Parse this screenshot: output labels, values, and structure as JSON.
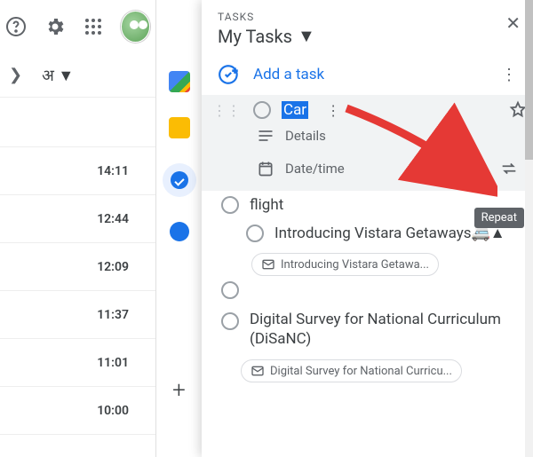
{
  "header": {
    "lang_label": "अ",
    "times": [
      "14:11",
      "12:44",
      "12:09",
      "11:37",
      "11:01",
      "10:00"
    ]
  },
  "tasks": {
    "section_label": "TASKS",
    "list_name": "My Tasks",
    "add_label": "Add a task",
    "editing": {
      "title_highlight": "Car",
      "details_label": "Details",
      "datetime_label": "Date/time",
      "tooltip": "Repeat"
    },
    "items": [
      {
        "title": "flight",
        "sub": {
          "title": "Introducing Vistara Getaways",
          "chip": "Introducing Vistara Getawa..."
        }
      },
      {
        "title": "Digital Survey for National Curriculum (DiSaNC)",
        "chip": "Digital Survey for National Curricu..."
      }
    ]
  }
}
